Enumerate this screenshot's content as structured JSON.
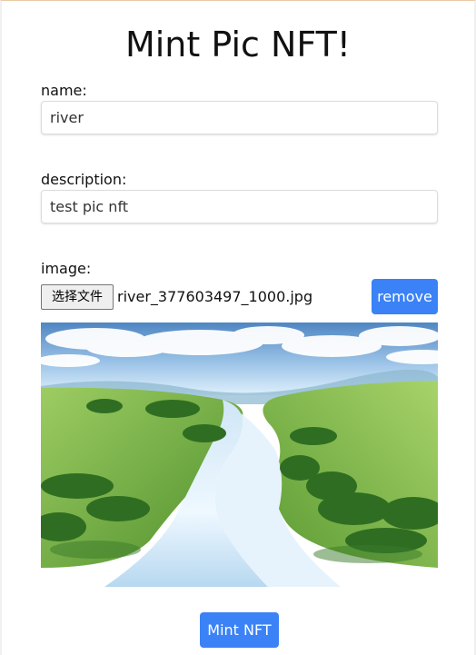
{
  "page": {
    "title": "Mint Pic NFT!"
  },
  "form": {
    "name_label": "name:",
    "name_value": "river",
    "description_label": "description:",
    "description_value": "test pic nft",
    "image_label": "image:",
    "file_button_label": "选择文件",
    "file_name": "river_377603497_1000.jpg",
    "remove_button_label": "remove",
    "mint_button_label": "Mint NFT"
  },
  "preview": {
    "subject": "river-landscape-image"
  },
  "colors": {
    "primary": "#3b82f6",
    "text": "#111111",
    "input_border": "#dcdcdc",
    "sky_top": "#5e93c9",
    "grass": "#7fb34d",
    "water": "#d7ecf7"
  }
}
